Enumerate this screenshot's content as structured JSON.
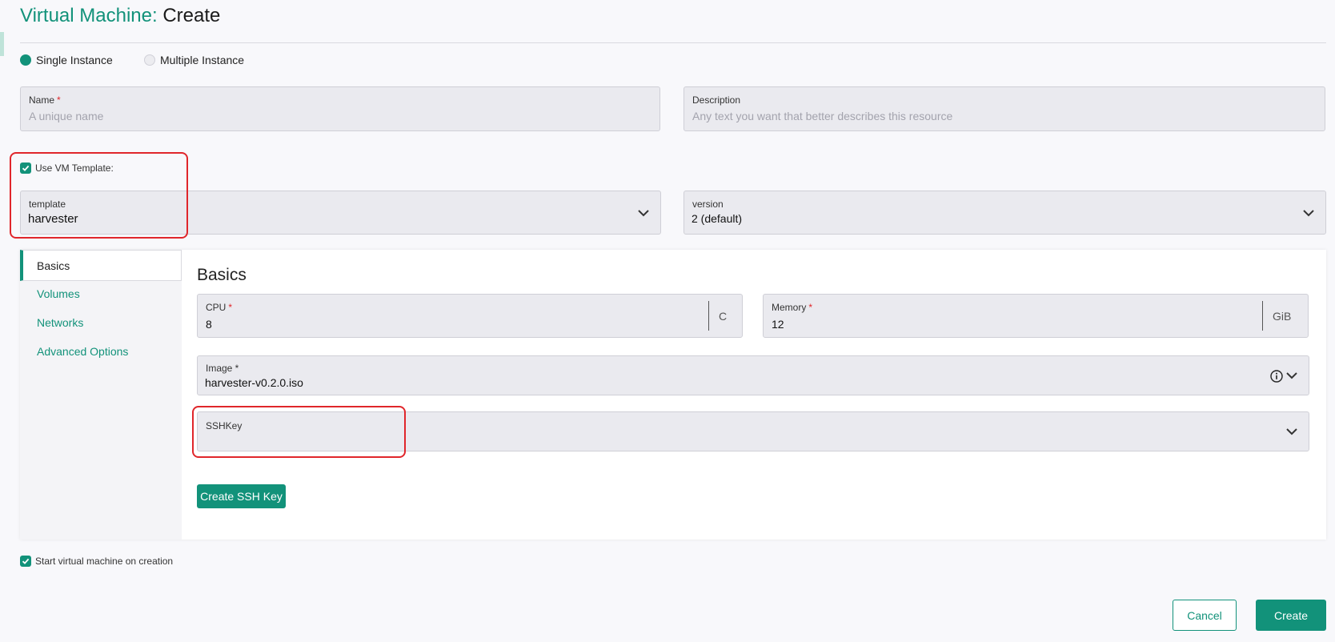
{
  "header": {
    "title_prefix": "Virtual Machine:",
    "title_action": "Create"
  },
  "instance_mode": {
    "options": [
      {
        "label": "Single Instance",
        "selected": true
      },
      {
        "label": "Multiple Instance",
        "selected": false
      }
    ]
  },
  "name_field": {
    "label": "Name",
    "required_mark": "*",
    "placeholder": "A unique name",
    "value": ""
  },
  "description_field": {
    "label": "Description",
    "placeholder": "Any text you want that better describes this resource",
    "value": ""
  },
  "use_template": {
    "label": "Use VM Template:",
    "checked": true
  },
  "template_select": {
    "label": "template",
    "value": "harvester"
  },
  "version_select": {
    "label": "version",
    "value": "2 (default)"
  },
  "sidebar": {
    "items": [
      {
        "label": "Basics",
        "active": true
      },
      {
        "label": "Volumes",
        "active": false
      },
      {
        "label": "Networks",
        "active": false
      },
      {
        "label": "Advanced Options",
        "active": false
      }
    ]
  },
  "basics": {
    "title": "Basics",
    "cpu": {
      "label": "CPU",
      "required_mark": "*",
      "value": "8",
      "unit": "C"
    },
    "memory": {
      "label": "Memory",
      "required_mark": "*",
      "value": "12",
      "unit": "GiB"
    },
    "image": {
      "label": "Image *",
      "value": "harvester-v0.2.0.iso"
    },
    "sshkey": {
      "label": "SSHKey",
      "value": ""
    },
    "create_ssh_key_label": "Create SSH Key"
  },
  "start_on_creation": {
    "label": "Start virtual machine on creation",
    "checked": true
  },
  "footer": {
    "cancel_label": "Cancel",
    "create_label": "Create"
  },
  "colors": {
    "accent": "#12927a",
    "highlight": "#e0262b",
    "field_bg": "#eaeaef"
  }
}
